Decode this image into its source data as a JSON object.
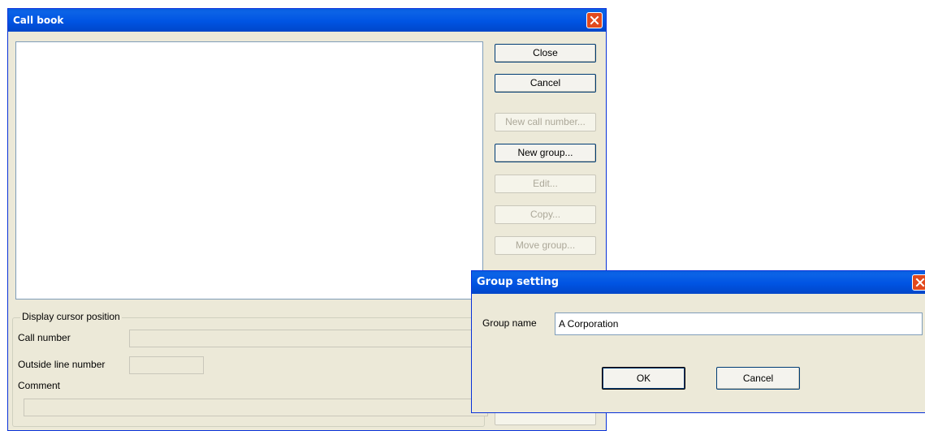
{
  "callbook": {
    "title": "Call book",
    "buttons": {
      "close": "Close",
      "cancel": "Cancel",
      "new_call_number": "New call number...",
      "new_group": "New group...",
      "edit": "Edit...",
      "copy": "Copy...",
      "move_group": "Move group..."
    },
    "display_cursor": {
      "legend": "Display cursor position",
      "call_number_label": "Call number",
      "call_number_value": "",
      "outside_line_label": "Outside line number",
      "outside_line_value": "",
      "comment_label": "Comment",
      "comment_value": ""
    }
  },
  "group_setting": {
    "title": "Group setting",
    "group_name_label": "Group name",
    "group_name_value": "A Corporation",
    "ok": "OK",
    "cancel": "Cancel"
  },
  "colors": {
    "titlebar": "#0054e3",
    "dialog_bg": "#ece9d8",
    "close_button": "#e2491d"
  },
  "icons": [
    "close-icon"
  ]
}
